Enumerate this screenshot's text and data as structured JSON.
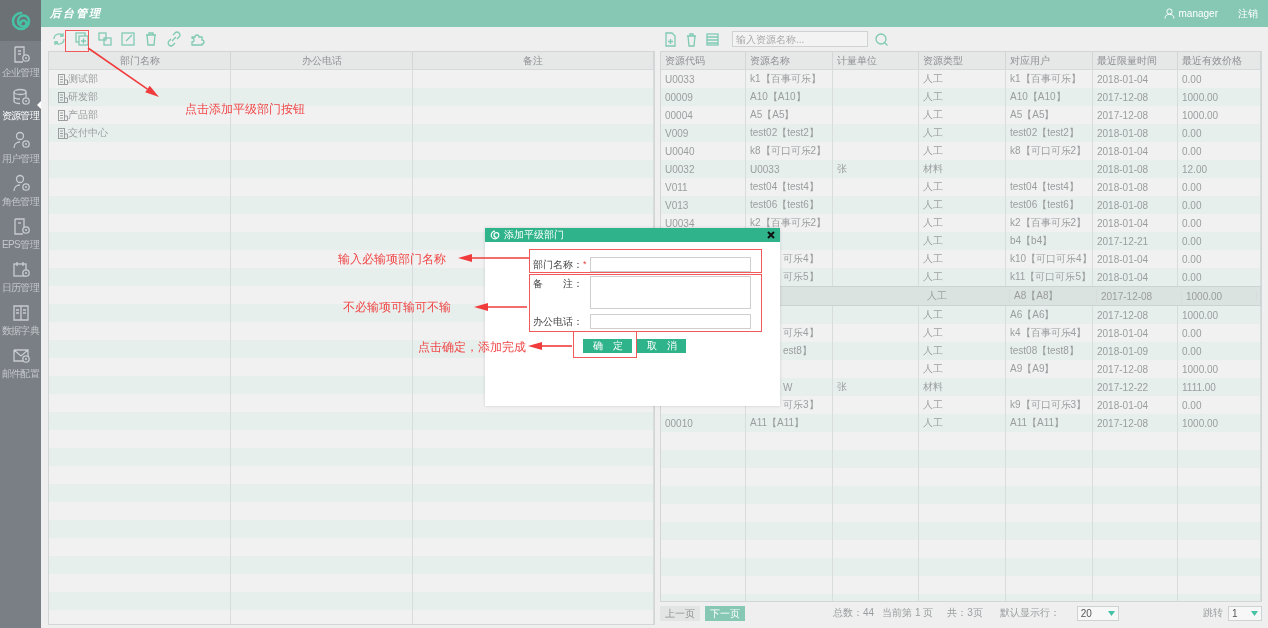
{
  "sidebar": {
    "items": [
      {
        "label": "企业管理",
        "selected": false
      },
      {
        "label": "资源管理",
        "selected": true
      },
      {
        "label": "用户管理",
        "selected": false
      },
      {
        "label": "角色管理",
        "selected": false
      },
      {
        "label": "EPS管理",
        "selected": false
      },
      {
        "label": "日历管理",
        "selected": false
      },
      {
        "label": "数据字典",
        "selected": false
      },
      {
        "label": "邮件配置",
        "selected": false
      }
    ]
  },
  "header": {
    "title": "后台管理",
    "user": "manager",
    "logout": "注销"
  },
  "department_table": {
    "columns": [
      "部门名称",
      "办公电话",
      "备注"
    ],
    "rows": [
      {
        "name": "测试部"
      },
      {
        "name": "研发部"
      },
      {
        "name": "产品部"
      },
      {
        "name": "交付中心"
      }
    ]
  },
  "resource_panel": {
    "search": {
      "placeholder": "输入资源名称..."
    },
    "table": {
      "columns": [
        "资源代码",
        "资源名称",
        "计量单位",
        "资源类型",
        "对应用户",
        "最近限量时间",
        "最近有效价格"
      ],
      "rows": [
        {
          "code": "U0033",
          "name": "k1【百事可乐】",
          "type": "人工",
          "user": "k1【百事可乐】",
          "date": "2018-01-04",
          "price": "0.00",
          "selected": false
        },
        {
          "code": "00009",
          "name": "A10【A10】",
          "type": "人工",
          "user": "A10【A10】",
          "date": "2017-12-08",
          "price": "1000.00",
          "selected": false
        },
        {
          "code": "00004",
          "name": "A5【A5】",
          "type": "人工",
          "user": "A5【A5】",
          "date": "2017-12-08",
          "price": "1000.00",
          "selected": false
        },
        {
          "code": "V009",
          "name": "test02【test2】",
          "type": "人工",
          "user": "test02【test2】",
          "date": "2018-01-08",
          "price": "0.00",
          "selected": false
        },
        {
          "code": "U0040",
          "name": "k8【可口可乐2】",
          "type": "人工",
          "user": "k8【可口可乐2】",
          "date": "2018-01-04",
          "price": "0.00",
          "selected": false
        },
        {
          "code": "U0032",
          "name": "U0033",
          "unit": "张",
          "type": "材料",
          "date": "2018-01-08",
          "price": "12.00",
          "selected": false
        },
        {
          "code": "V011",
          "name": "test04【test4】",
          "type": "人工",
          "user": "test04【test4】",
          "date": "2018-01-08",
          "price": "0.00",
          "selected": false
        },
        {
          "code": "V013",
          "name": "test06【test6】",
          "type": "人工",
          "user": "test06【test6】",
          "date": "2018-01-08",
          "price": "0.00",
          "selected": false
        },
        {
          "code": "U0034",
          "name": "k2【百事可乐2】",
          "type": "人工",
          "user": "k2【百事可乐2】",
          "date": "2018-01-04",
          "price": "0.00",
          "selected": false
        },
        {
          "type": "人工",
          "user": "b4【b4】",
          "date": "2017-12-21",
          "price": "0.00",
          "selected": false
        },
        {
          "name": "可乐4】",
          "type": "人工",
          "user": "k10【可口可乐4】",
          "date": "2018-01-04",
          "price": "0.00",
          "selected": false
        },
        {
          "name": "可乐5】",
          "type": "人工",
          "user": "k11【可口可乐5】",
          "date": "2018-01-04",
          "price": "0.00",
          "selected": false
        },
        {
          "type": "人工",
          "user": "A8【A8】",
          "date": "2017-12-08",
          "price": "1000.00",
          "selected": true
        },
        {
          "type": "人工",
          "user": "A6【A6】",
          "date": "2017-12-08",
          "price": "1000.00",
          "selected": false
        },
        {
          "name": "可乐4】",
          "type": "人工",
          "user": "k4【百事可乐4】",
          "date": "2018-01-04",
          "price": "0.00",
          "selected": false
        },
        {
          "name": "est8】",
          "type": "人工",
          "user": "test08【test8】",
          "date": "2018-01-09",
          "price": "0.00",
          "selected": false
        },
        {
          "type": "人工",
          "user": "A9【A9】",
          "date": "2017-12-08",
          "price": "1000.00",
          "selected": false
        },
        {
          "name": "W",
          "unit": "张",
          "type": "材料",
          "date": "2017-12-22",
          "price": "1111.00",
          "selected": false
        },
        {
          "name": "可乐3】",
          "type": "人工",
          "user": "k9【可口可乐3】",
          "date": "2018-01-04",
          "price": "0.00",
          "selected": false
        },
        {
          "code": "00010",
          "name": "A11【A11】",
          "type": "人工",
          "user": "A11【A11】",
          "date": "2017-12-08",
          "price": "1000.00",
          "selected": false
        }
      ]
    },
    "pager": {
      "prev": {
        "label": "上一页",
        "disabled": true
      },
      "next": {
        "label": "下一页",
        "disabled": false
      },
      "total": "总数：44",
      "current": "当前第 1 页",
      "pages": "共：3页",
      "page_size_label": "默认显示行：",
      "page_size": "20",
      "jump_label": "跳转",
      "jump_page": "1"
    }
  },
  "dialog": {
    "title": "添加平级部门",
    "required_mark": "*",
    "fields": [
      {
        "label": "部门名称：",
        "required": true,
        "kind": "input"
      },
      {
        "label": "备　　注：",
        "required": false,
        "kind": "textarea"
      },
      {
        "label": "办公电话：",
        "required": false,
        "kind": "input"
      }
    ],
    "buttons": [
      "确　定",
      "取　消"
    ]
  },
  "annotations": [
    "点击添加平级部门按钮",
    "输入必输项部门名称",
    "不必输项可输可不输",
    "点击确定，添加完成"
  ]
}
